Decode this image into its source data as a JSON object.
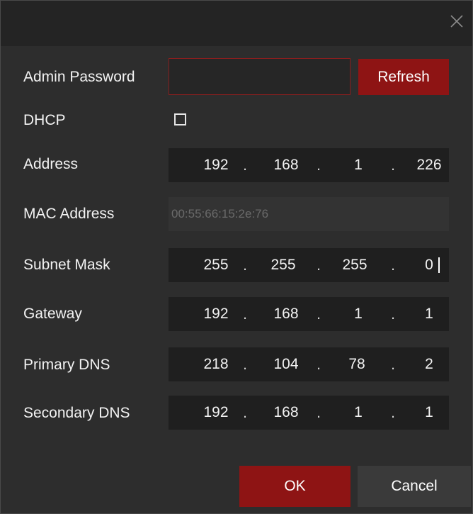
{
  "dialog": {
    "close_icon": "close-icon"
  },
  "labels": {
    "admin_password": "Admin Password",
    "dhcp": "DHCP",
    "address": "Address",
    "mac_address": "MAC Address",
    "subnet_mask": "Subnet Mask",
    "gateway": "Gateway",
    "primary_dns": "Primary DNS",
    "secondary_dns": "Secondary DNS"
  },
  "buttons": {
    "refresh": "Refresh",
    "ok": "OK",
    "cancel": "Cancel"
  },
  "fields": {
    "admin_password": "",
    "dhcp_checked": false,
    "mac_address": "00:55:66:15:2e:76",
    "address": [
      "192",
      "168",
      "1",
      "226"
    ],
    "subnet_mask": [
      "255",
      "255",
      "255",
      "0"
    ],
    "gateway": [
      "192",
      "168",
      "1",
      "1"
    ],
    "primary_dns": [
      "218",
      "104",
      "78",
      "2"
    ],
    "secondary_dns": [
      "192",
      "168",
      "1",
      "1"
    ],
    "separator": "."
  },
  "colors": {
    "accent": "#8e1414",
    "background": "#2d2d2d",
    "field": "#1f1f1f"
  }
}
